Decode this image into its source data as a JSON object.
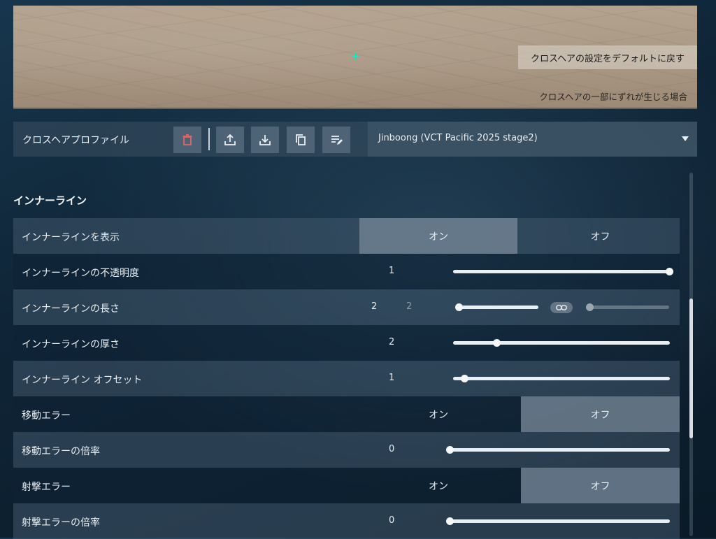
{
  "preview": {
    "reset_label": "クロスヘアの設定をデフォルトに戻す",
    "misalign_label": "クロスヘアの一部にずれが生じる場合"
  },
  "profile": {
    "label": "クロスヘアプロファイル",
    "selected": "Jinboong (VCT Pacific 2025 stage2)",
    "icons": [
      "trash-icon",
      "upload-icon",
      "download-icon",
      "copy-icon",
      "edit-list-icon"
    ]
  },
  "section": {
    "title": "インナーライン"
  },
  "rows": [
    {
      "label": "インナーラインを表示",
      "type": "toggle",
      "on": "オン",
      "off": "オフ",
      "selected": "on"
    },
    {
      "label": "インナーラインの不透明度",
      "type": "slider",
      "value": "1",
      "fraction": 1.0
    },
    {
      "label": "インナーラインの長さ",
      "type": "dual",
      "value1": "2",
      "value2": "2",
      "fraction1": 0.02,
      "fraction2": 0.02
    },
    {
      "label": "インナーラインの厚さ",
      "type": "slider",
      "value": "2",
      "fraction": 0.2
    },
    {
      "label": "インナーライン オフセット",
      "type": "slider",
      "value": "1",
      "fraction": 0.05
    },
    {
      "label": "移動エラー",
      "type": "toggle",
      "on": "オン",
      "off": "オフ",
      "selected": "off"
    },
    {
      "label": "移動エラーの倍率",
      "type": "slider",
      "value": "0",
      "fraction": 0.0
    },
    {
      "label": "射撃エラー",
      "type": "toggle",
      "on": "オン",
      "off": "オフ",
      "selected": "off"
    },
    {
      "label": "射撃エラーの倍率",
      "type": "slider",
      "value": "0",
      "fraction": 0.0
    }
  ],
  "colors": {
    "accent": "#1ee6c4",
    "trash": "#e0666b"
  }
}
